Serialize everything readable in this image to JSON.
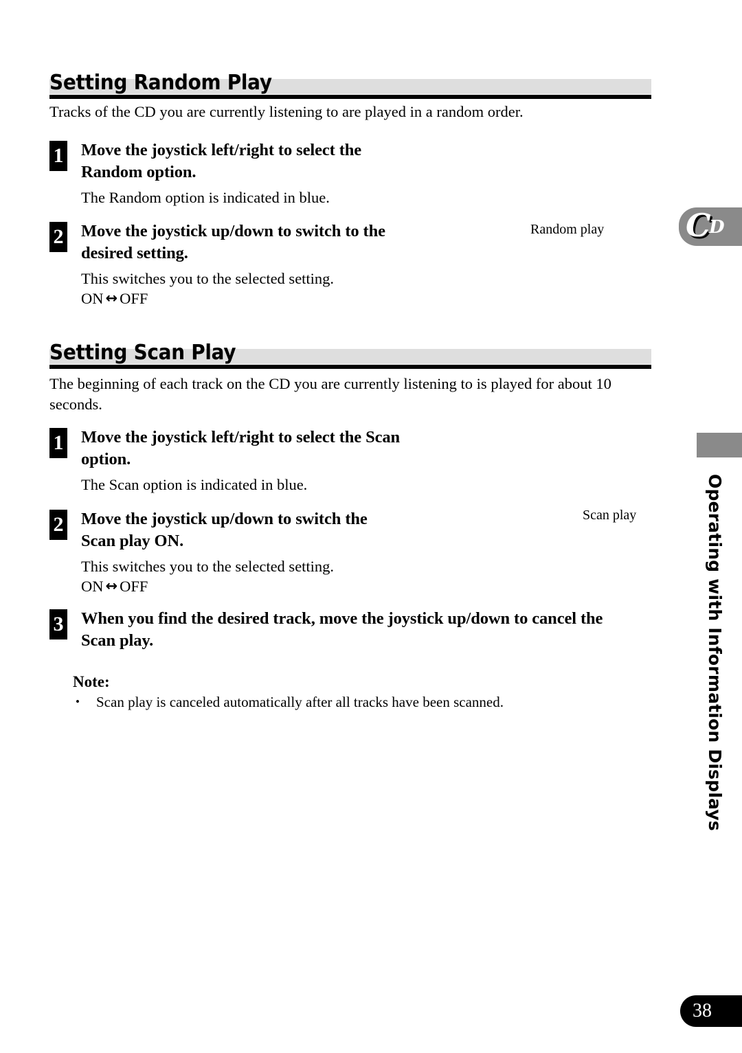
{
  "page": {
    "number": "38",
    "chapter_tab_label": "Operating with Information Displays"
  },
  "cd_marker": {
    "letter_main": "C",
    "letter_sub": "D"
  },
  "sections": [
    {
      "heading": "Setting Random Play",
      "intro": "Tracks of the CD you are currently listening to are played in a random order.",
      "caption": "Random play",
      "steps": [
        {
          "number": "1",
          "title_line1": "Move the joystick left/right to select the",
          "title_line2": "Random option.",
          "detail": "The Random option is indicated in blue.",
          "toggle_on": "",
          "toggle_arrow": "",
          "toggle_off": ""
        },
        {
          "number": "2",
          "title_line1": "Move the joystick up/down to switch to the",
          "title_line2": "desired setting.",
          "detail": "This switches you to the selected setting.",
          "toggle_on": "ON",
          "toggle_arrow": "↔",
          "toggle_off": "OFF"
        }
      ]
    },
    {
      "heading": "Setting Scan Play",
      "intro_line1": "The beginning of each track on the CD you are currently listening to is played for about 10",
      "intro_line2": "seconds.",
      "caption": "Scan play",
      "steps": [
        {
          "number": "1",
          "title_line1": "Move the joystick left/right to select the Scan",
          "title_line2": "option.",
          "detail": "The Scan option is indicated in blue."
        },
        {
          "number": "2",
          "title_line1": "Move the joystick up/down to switch the",
          "title_line2": "Scan play ON.",
          "detail": "This switches you to the selected setting.",
          "toggle_on": "ON",
          "toggle_arrow": "↔",
          "toggle_off": "OFF"
        },
        {
          "number": "3",
          "title_line1": "When you find the desired track, move the joystick up/down to cancel the",
          "title_line2": "Scan play."
        }
      ],
      "note": {
        "title": "Note:",
        "bullet": "•",
        "items": [
          "Scan play is canceled automatically after all tracks have been scanned."
        ]
      }
    }
  ]
}
